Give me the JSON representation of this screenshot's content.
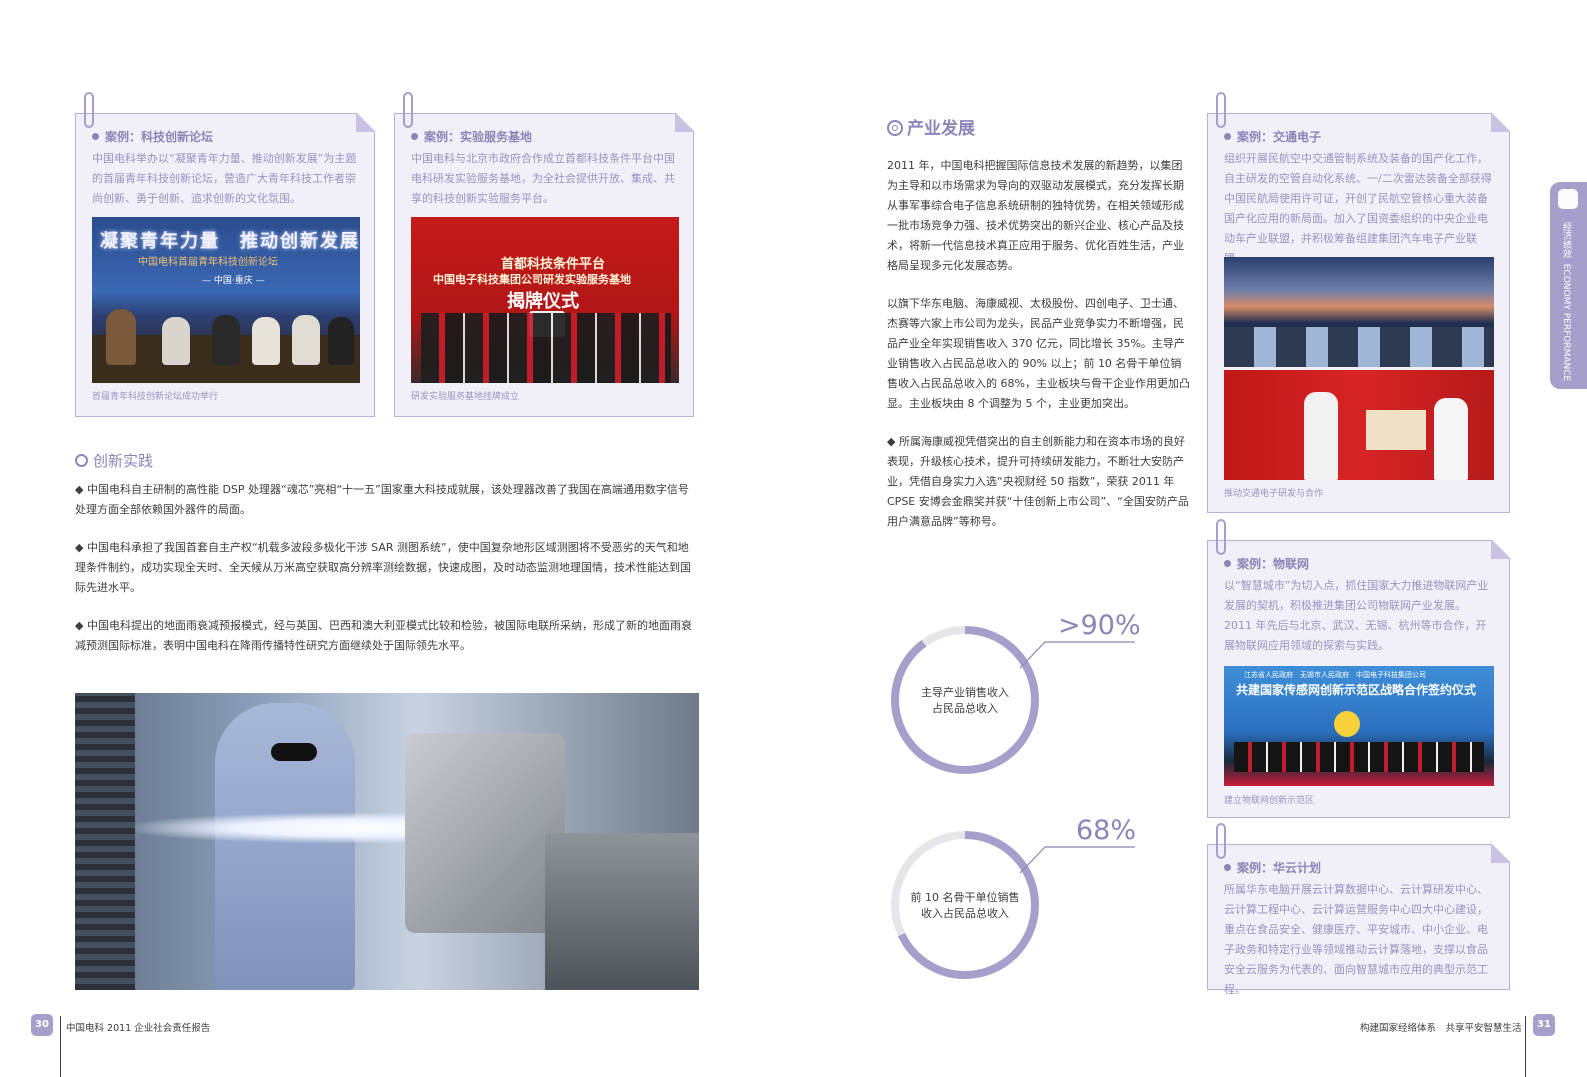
{
  "left_page": {
    "case_sci_forum": {
      "title": "案例：科技创新论坛",
      "text": "中国电科举办以“凝聚青年力量、推动创新发展”为主题的首届青年科技创新论坛，营造广大青年科技工作者崇尚创新、勇于创新、追求创新的文化氛围。",
      "photo_banner_line1": "凝聚青年力量　推动创新发展",
      "photo_banner_line2": "中国电科首届青年科技创新论坛",
      "photo_banner_line3": "— 中国·重庆 —",
      "caption": "首届青年科技创新论坛成功举行"
    },
    "case_lab_base": {
      "title": "案例：实验服务基地",
      "text": "中国电科与北京市政府合作成立首都科技条件平台中国电科研发实验服务基地，为全社会提供开放、集成、共享的科技创新实验服务平台。",
      "photo_banner_line1": "首都科技条件平台",
      "photo_banner_line2": "中国电子科技集团公司研发实验服务基地",
      "photo_banner_line3": "揭牌仪式",
      "caption": "研发实验服务基地挂牌成立"
    },
    "innovation": {
      "title": "创新实践",
      "paragraphs": [
        "◆ 中国电科自主研制的高性能 DSP 处理器“魂芯”亮相“十一五”国家重大科技成就展，该处理器改善了我国在高端通用数字信号处理方面全部依赖国外器件的局面。",
        "◆ 中国电科承担了我国首套自主产权“机载多波段多极化干涉 SAR 测图系统”，使中国复杂地形区域测图将不受恶劣的天气和地理条件制约，成功实现全天时、全天候从万米高空获取高分辨率测绘数据，快速成图，及时动态监测地理国情，技术性能达到国际先进水平。",
        "◆ 中国电科提出的地面雨衰减预报模式，经与英国、巴西和澳大利亚模式比较和检验，被国际电联所采纳，形成了新的地面雨衰减预测国际标准，表明中国电科在降雨传播特性研究方面继续处于国际领先水平。"
      ]
    },
    "footer": {
      "page_number": "30",
      "report_title": "中国电科 2011 企业社会责任报告"
    }
  },
  "right_page": {
    "industry": {
      "title": "产业发展",
      "paragraphs": [
        "2011 年，中国电科把握国际信息技术发展的新趋势，以集团为主导和以市场需求为导向的双驱动发展模式，充分发挥长期从事军事综合电子信息系统研制的独特优势，在相关领域形成一批市场竞争力强、技术优势突出的新兴企业、核心产品及技术，将新一代信息技术真正应用于服务、优化百姓生活，产业格局呈现多元化发展态势。",
        "以旗下华东电脑、海康威视、太极股份、四创电子、卫士通、杰赛等六家上市公司为龙头，民品产业竞争实力不断增强，民品产业全年实现销售收入 370 亿元，同比增长 35%。主导产业销售收入占民品总收入的 90% 以上；前 10 名骨干单位销售收入占民品总收入的 68%，主业板块与骨干企业作用更加凸显。主业板块由 8 个调整为 5 个，主业更加突出。",
        "◆ 所属海康威视凭借突出的自主创新能力和在资本市场的良好表现，升级核心技术，提升可持续研发能力，不断壮大安防产业，凭借自身实力入选“央视财经 50 指数”，荣获 2011 年 CPSE 安博会金鼎奖并获“十佳创新上市公司”、“全国安防产品用户满意品牌”等称号。"
      ]
    },
    "stats": [
      {
        "value_label": ">90%",
        "fraction": 0.9,
        "label_line1": "主导产业销售收入",
        "label_line2": "占民品总收入"
      },
      {
        "value_label": "68%",
        "fraction": 0.68,
        "label_line1": "前 10 名骨干单位销售",
        "label_line2": "收入占民品总收入"
      }
    ],
    "case_traffic": {
      "title": "案例：交通电子",
      "text": "组织开展民航空中交通管制系统及装备的国产化工作，自主研发的空管自动化系统、一/二次雷达装备全部获得中国民航局使用许可证，开创了民航空管核心重大装备国产化应用的新局面。加入了国资委组织的中央企业电动车产业联盟，并积极筹备组建集团汽车电子产业联盟。",
      "caption": "推动交通电子研发与合作"
    },
    "case_iot": {
      "title": "案例：物联网",
      "text": "以“智慧城市”为切入点，抓住国家大力推进物联网产业发展的契机，积极推进集团公司物联网产业发展。2011 年先后与北京、武汉、无锡、杭州等市合作，开展物联网应用领域的探索与实践。",
      "photo_banner_line1": "江苏省人民政府　无锡市人民政府　中国电子科技集团公司",
      "photo_banner_line2": "共建国家传感网创新示范区战略合作签约仪式",
      "caption": "建立物联网创新示范区"
    },
    "case_cloud": {
      "title": "案例：华云计划",
      "text": "所属华东电脑开展云计算数据中心、云计算研发中心、云计算工程中心、云计算运营服务中心四大中心建设，重点在食品安全、健康医疗、平安城市、中小企业、电子政务和特定行业等领域推动云计算落地，支撑以食品安全云服务为代表的、面向智慧城市应用的典型示范工程。"
    },
    "side_tab": {
      "cn": "经济绩效",
      "en": "ECONOMY PERFORMANCE"
    },
    "footer": {
      "page_number": "31",
      "slogan": "构建国家经络体系　共享平安智慧生活"
    }
  },
  "colors": {
    "accent": "#8d85b8",
    "card_bg": "#f1eff8",
    "card_border": "#b8b0d8",
    "ring_track": "#e6e6ea",
    "ring_fill": "#a79fcb"
  }
}
